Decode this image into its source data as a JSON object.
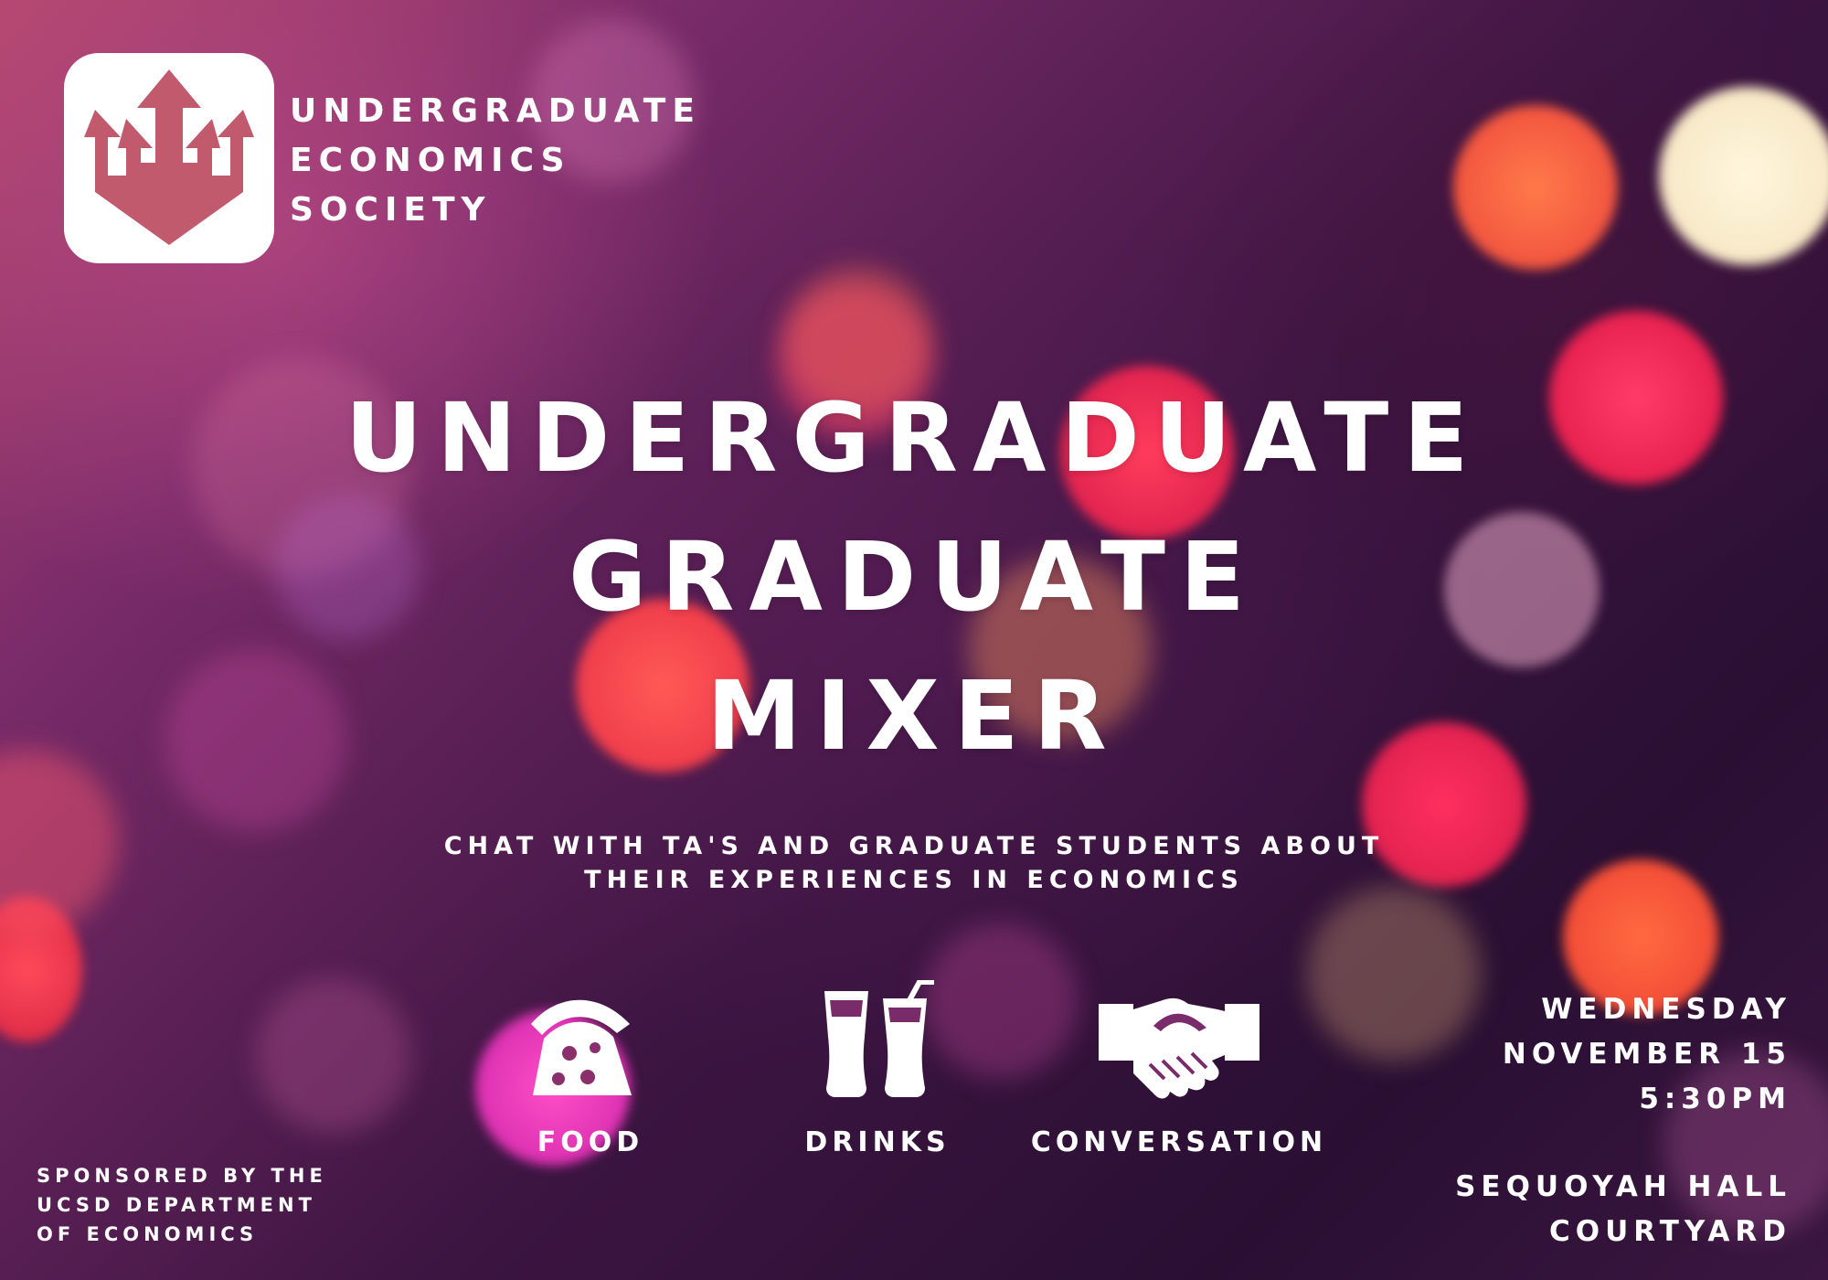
{
  "organization": {
    "lines": [
      "UNDERGRADUATE",
      "ECONOMICS",
      "SOCIETY"
    ],
    "logo_icon": "trident-icon",
    "logo_color": "#c25a6e"
  },
  "title": {
    "lines": [
      "UNDERGRADUATE",
      "GRADUATE",
      "MIXER"
    ]
  },
  "subtitle": {
    "lines": [
      "CHAT WITH TA'S AND GRADUATE STUDENTS ABOUT",
      "THEIR EXPERIENCES IN ECONOMICS"
    ]
  },
  "features": [
    {
      "icon": "pizza-slice-icon",
      "label": "FOOD"
    },
    {
      "icon": "drinks-glasses-icon",
      "label": "DRINKS"
    },
    {
      "icon": "handshake-icon",
      "label": "CONVERSATION"
    }
  ],
  "sponsor": {
    "lines": [
      "SPONSORED BY THE",
      "UCSD DEPARTMENT",
      "OF ECONOMICS"
    ]
  },
  "event": {
    "day": "WEDNESDAY",
    "date": "NOVEMBER 15",
    "time": "5:30PM",
    "location_lines": [
      "SEQUOYAH HALL",
      "COURTYARD"
    ]
  },
  "colors": {
    "background_dark": "#2a0f33",
    "background_pink": "#b4486f",
    "text": "#ffffff"
  }
}
